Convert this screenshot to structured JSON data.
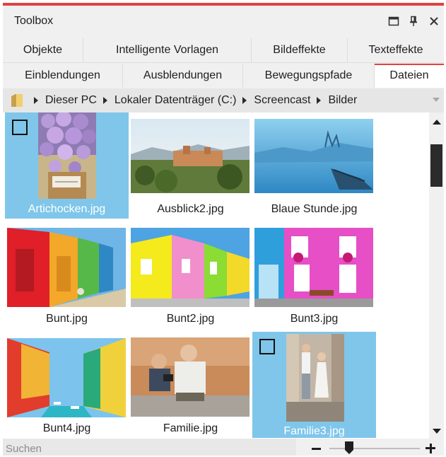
{
  "window": {
    "title": "Toolbox"
  },
  "tabs_row1": [
    {
      "label": "Objekte"
    },
    {
      "label": "Intelligente Vorlagen"
    },
    {
      "label": "Bildeffekte"
    },
    {
      "label": "Texteffekte"
    }
  ],
  "tabs_row2": [
    {
      "label": "Einblendungen"
    },
    {
      "label": "Ausblendungen"
    },
    {
      "label": "Bewegungspfade"
    },
    {
      "label": "Dateien",
      "active": true
    }
  ],
  "breadcrumb": [
    "Dieser PC",
    "Lokaler Datenträger (C:)",
    "Screencast",
    "Bilder"
  ],
  "files": [
    {
      "name": "Artichocken.jpg",
      "selected": true
    },
    {
      "name": "Ausblick2.jpg",
      "selected": false
    },
    {
      "name": "Blaue Stunde.jpg",
      "selected": false
    },
    {
      "name": "Bunt.jpg",
      "selected": false
    },
    {
      "name": "Bunt2.jpg",
      "selected": false
    },
    {
      "name": "Bunt3.jpg",
      "selected": false
    },
    {
      "name": "Bunt4.jpg",
      "selected": false
    },
    {
      "name": "Familie.jpg",
      "selected": false
    },
    {
      "name": "Familie3.jpg",
      "selected": true
    }
  ],
  "search": {
    "placeholder": "Suchen",
    "value": ""
  },
  "zoom": {
    "level": 0.22
  },
  "colors": {
    "accent": "#e04141",
    "selection": "#7fc6ea"
  },
  "icons": [
    "folder-icon",
    "maximize-icon",
    "pin-icon",
    "close-icon",
    "chevron-right-icon",
    "dropdown-arrow-icon",
    "scroll-up-icon",
    "scroll-down-icon",
    "zoom-minus-icon",
    "zoom-plus-icon",
    "checkbox-icon"
  ]
}
